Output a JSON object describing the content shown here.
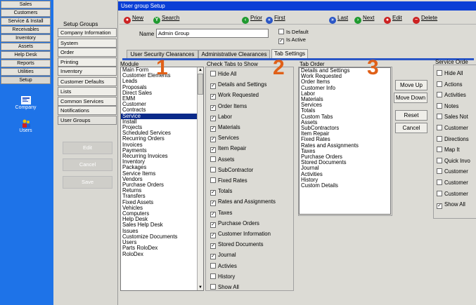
{
  "nav": {
    "items": [
      "Sales",
      "Customers",
      "Service & Install",
      "Receivables",
      "Inventory",
      "Assets",
      "Help Desk",
      "Reports",
      "Utilities",
      "Setup"
    ],
    "icons": [
      {
        "label": "Company",
        "icon": "company-icon"
      },
      {
        "label": "Users",
        "icon": "users-icon"
      }
    ]
  },
  "groups": {
    "title": "Setup Groups",
    "items": [
      "Company Information",
      "System",
      "Order",
      "Printing",
      "Inventory",
      "Customer Defaults",
      "Lists",
      "Common Services",
      "Notifications",
      "User Groups"
    ],
    "buttons": {
      "edit": "Edit",
      "cancel": "Cancel",
      "save": "Save"
    }
  },
  "window": {
    "title": "User group Setup",
    "toolbar": {
      "new": "New",
      "search": "Search",
      "prior": "Prior",
      "first": "First",
      "last": "Last",
      "next": "Next",
      "edit": "Edit",
      "delete": "Delete"
    },
    "name_label": "Name",
    "name_value": "Admin Group",
    "is_default": "Is Default",
    "is_active": "Is Active",
    "tabs": [
      "User Security Clearances",
      "Administrative Clearances",
      "Tab Settings"
    ]
  },
  "module": {
    "title": "Module",
    "items": [
      "Main Form",
      "Customer Elements",
      "Leads",
      "Proposals",
      "Direct Sales",
      "EMM",
      "Customer",
      "Contracts",
      "Service",
      "Install",
      "Projects",
      "Scheduled Services",
      "Recurring Orders",
      "Invoices",
      "Payments",
      "Recurring Invoices",
      "Inventory",
      "Packages",
      "Service Items",
      "Vendors",
      "Purchase Orders",
      "Returns",
      "Transfers",
      "Fixed Assets",
      "Vehicles",
      "Computers",
      "Help Desk",
      "Sales Help Desk",
      "Issues",
      "Customize Documents",
      "Users",
      "Parts RoloDex",
      "RoloDex"
    ],
    "selected": "Service"
  },
  "check_tabs": {
    "title": "Check Tabs to Show",
    "items": [
      {
        "label": "Hide All",
        "checked": false
      },
      {
        "label": "Details and Settings",
        "checked": true
      },
      {
        "label": "Work Requested",
        "checked": true
      },
      {
        "label": "Order Items",
        "checked": true
      },
      {
        "label": "Labor",
        "checked": true
      },
      {
        "label": "Materials",
        "checked": true
      },
      {
        "label": "Services",
        "checked": true
      },
      {
        "label": "Item Repair",
        "checked": true
      },
      {
        "label": "Assets",
        "checked": false
      },
      {
        "label": "SubContractor",
        "checked": false
      },
      {
        "label": "Fixed Rates",
        "checked": false
      },
      {
        "label": "Totals",
        "checked": true
      },
      {
        "label": "Rates and Assignments",
        "checked": true
      },
      {
        "label": "Taxes",
        "checked": true
      },
      {
        "label": "Purchase Orders",
        "checked": true
      },
      {
        "label": "Customer Information",
        "checked": true
      },
      {
        "label": "Stored Documents",
        "checked": true
      },
      {
        "label": "Journal",
        "checked": true
      },
      {
        "label": "Activies",
        "checked": false
      },
      {
        "label": "History",
        "checked": false
      },
      {
        "label": "Show All",
        "checked": false
      }
    ]
  },
  "tab_order": {
    "title": "Tab Order",
    "items": [
      "Details and Settings",
      "Work Requested",
      "Order Items",
      "Customer Info",
      "Labor",
      "Materials",
      "Services",
      "Totals",
      "Custom Tabs",
      "Assets",
      "SubContractors",
      "Item Repair",
      "Fixed Rates",
      "Rates and Assignments",
      "Taxes",
      "Purchase Orders",
      "Stored Documents",
      "Journal",
      "Activities",
      "History",
      "Custom Details"
    ],
    "buttons": {
      "move_up": "Move Up",
      "move_down": "Move Down",
      "reset": "Reset",
      "cancel": "Cancel"
    }
  },
  "service_orders": {
    "title": "Service Orde",
    "items": [
      {
        "label": "Hide All",
        "checked": false
      },
      {
        "label": "Actions",
        "checked": false
      },
      {
        "label": "Activities",
        "checked": false
      },
      {
        "label": "Notes",
        "checked": false
      },
      {
        "label": "Sales Not",
        "checked": false
      },
      {
        "label": "Customer",
        "checked": false
      },
      {
        "label": "Directions",
        "checked": false
      },
      {
        "label": "Map It",
        "checked": false
      },
      {
        "label": "Quick Invo",
        "checked": false
      },
      {
        "label": "Customer",
        "checked": false
      },
      {
        "label": "Customer",
        "checked": false
      },
      {
        "label": "Customer",
        "checked": false
      },
      {
        "label": "Show All",
        "checked": true
      }
    ]
  },
  "step_numbers": [
    "1",
    "2",
    "3"
  ]
}
